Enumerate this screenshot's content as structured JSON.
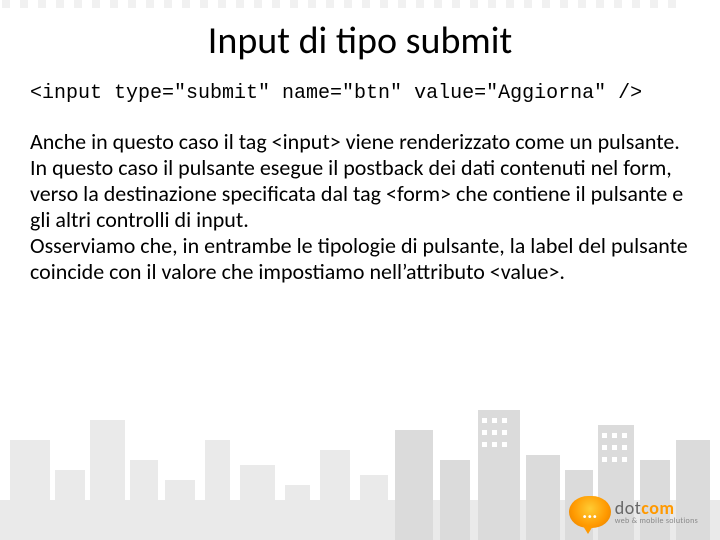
{
  "slide": {
    "title": "Input di tipo submit",
    "code": "<input type=\"submit\" name=\"btn\" value=\"Aggiorna\" />",
    "p1": "Anche in questo caso il tag <input> viene renderizzato come un pulsante.",
    "p2": "In questo caso il pulsante esegue il postback dei dati contenuti nel form, verso la destinazione specificata dal tag <form> che contiene il pulsante e gli altri controlli di input.",
    "p3": "Osserviamo che, in entrambe le tipologie di pulsante, la label del pulsante coincide con il valore che impostiamo nell’attributo <value>."
  },
  "logo": {
    "dots": "...",
    "brand_prefix": "dot",
    "brand_suffix": "com",
    "tagline": "web & mobile solutions"
  }
}
